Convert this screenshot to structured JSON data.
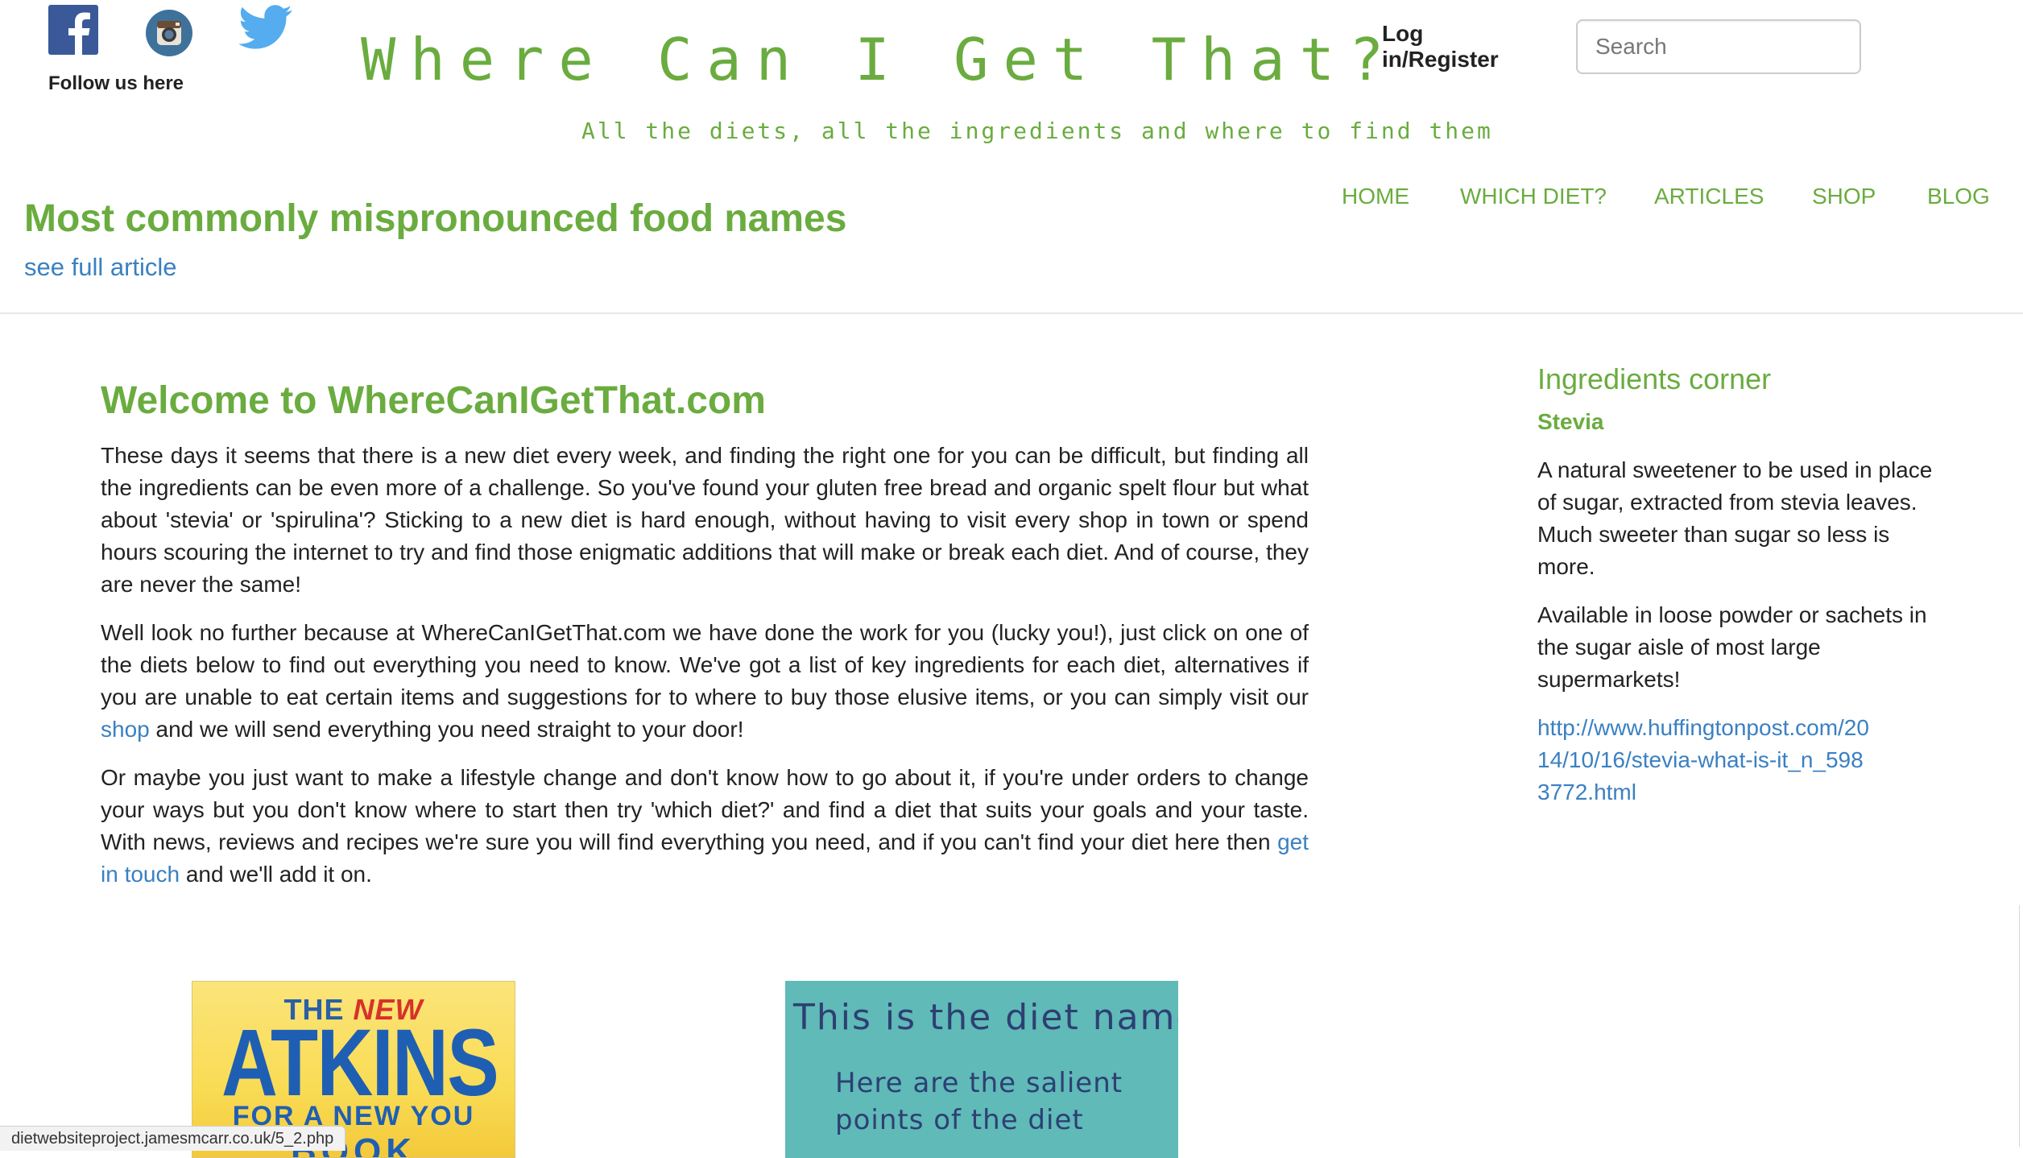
{
  "social": {
    "follow_label": "Follow us here",
    "icons": [
      "facebook-icon",
      "instagram-icon",
      "twitter-icon"
    ],
    "colors": {
      "facebook": "#3b5998",
      "instagram": "#3f729b",
      "twitter": "#55acee"
    }
  },
  "site": {
    "title": "Where Can I Get That?",
    "tagline": "All the diets, all the ingredients and where to find them",
    "accent_color": "#6aac3f",
    "link_color": "#3a80c2"
  },
  "auth": {
    "login_label": "Log in/Register"
  },
  "search": {
    "placeholder": "Search",
    "value": ""
  },
  "nav": {
    "items": [
      {
        "label": "HOME"
      },
      {
        "label": "WHICH DIET?"
      },
      {
        "label": "ARTICLES"
      },
      {
        "label": "SHOP"
      },
      {
        "label": "BLOG"
      }
    ]
  },
  "featured": {
    "title": "Most commonly mispronounced food names",
    "link_label": "see full article"
  },
  "main": {
    "heading": "Welcome to WhereCanIGetThat.com",
    "p1": "These days it seems that there is a new diet every week, and finding the right one for you can be difficult, but finding all the ingredients can be even more of a challenge. So you've found your gluten free bread and organic spelt flour but what about 'stevia' or 'spirulina'? Sticking to a new diet is hard enough, without having to visit every shop in town or spend hours scouring the internet to try and find those enigmatic additions that will make or break each diet. And of course, they are never the same!",
    "p2_before": "Well look no further because at WhereCanIGetThat.com we have done the work for you (lucky you!), just click on one of the diets below to find out everything you need to know. We've got a list of key ingredients for each diet, alternatives if you are unable to eat certain items and suggestions for to where to buy those elusive items, or you can simply visit our ",
    "p2_link": "shop",
    "p2_after": " and we will send everything you need straight to your door!",
    "p3_before": "Or maybe you just want to make a lifestyle change and don't know how to go about it, if you're under orders to change your ways but you don't know where to start then try 'which diet?' and find a diet that suits your goals and your taste. With news, reviews and recipes we're sure you will find everything you need, and if you can't find your diet here then ",
    "p3_link": "get in touch",
    "p3_after": " and we'll add it on."
  },
  "sidebar": {
    "heading": "Ingredients corner",
    "subheading": "Stevia",
    "p1": "A natural sweetener to be used in place of sugar, extracted from stevia leaves. Much sweeter than sugar so less is more.",
    "p2": "Available in loose powder or sachets in the sugar aisle of most large supermarkets!",
    "link": "http://www.huffingtonpost.com/2014/10/16/stevia-what-is-it_n_5983772.html"
  },
  "cards": {
    "book": {
      "line1_a": "THE ",
      "line1_b": "NEW",
      "line2": "ATKINS",
      "line3": "FOR A NEW YOU",
      "line4": "BOOK"
    },
    "diet": {
      "title": "This is the diet name",
      "subtitle": "Here are the salient points of the diet"
    }
  },
  "status_url": "dietwebsiteproject.jamesmcarr.co.uk/5_2.php"
}
